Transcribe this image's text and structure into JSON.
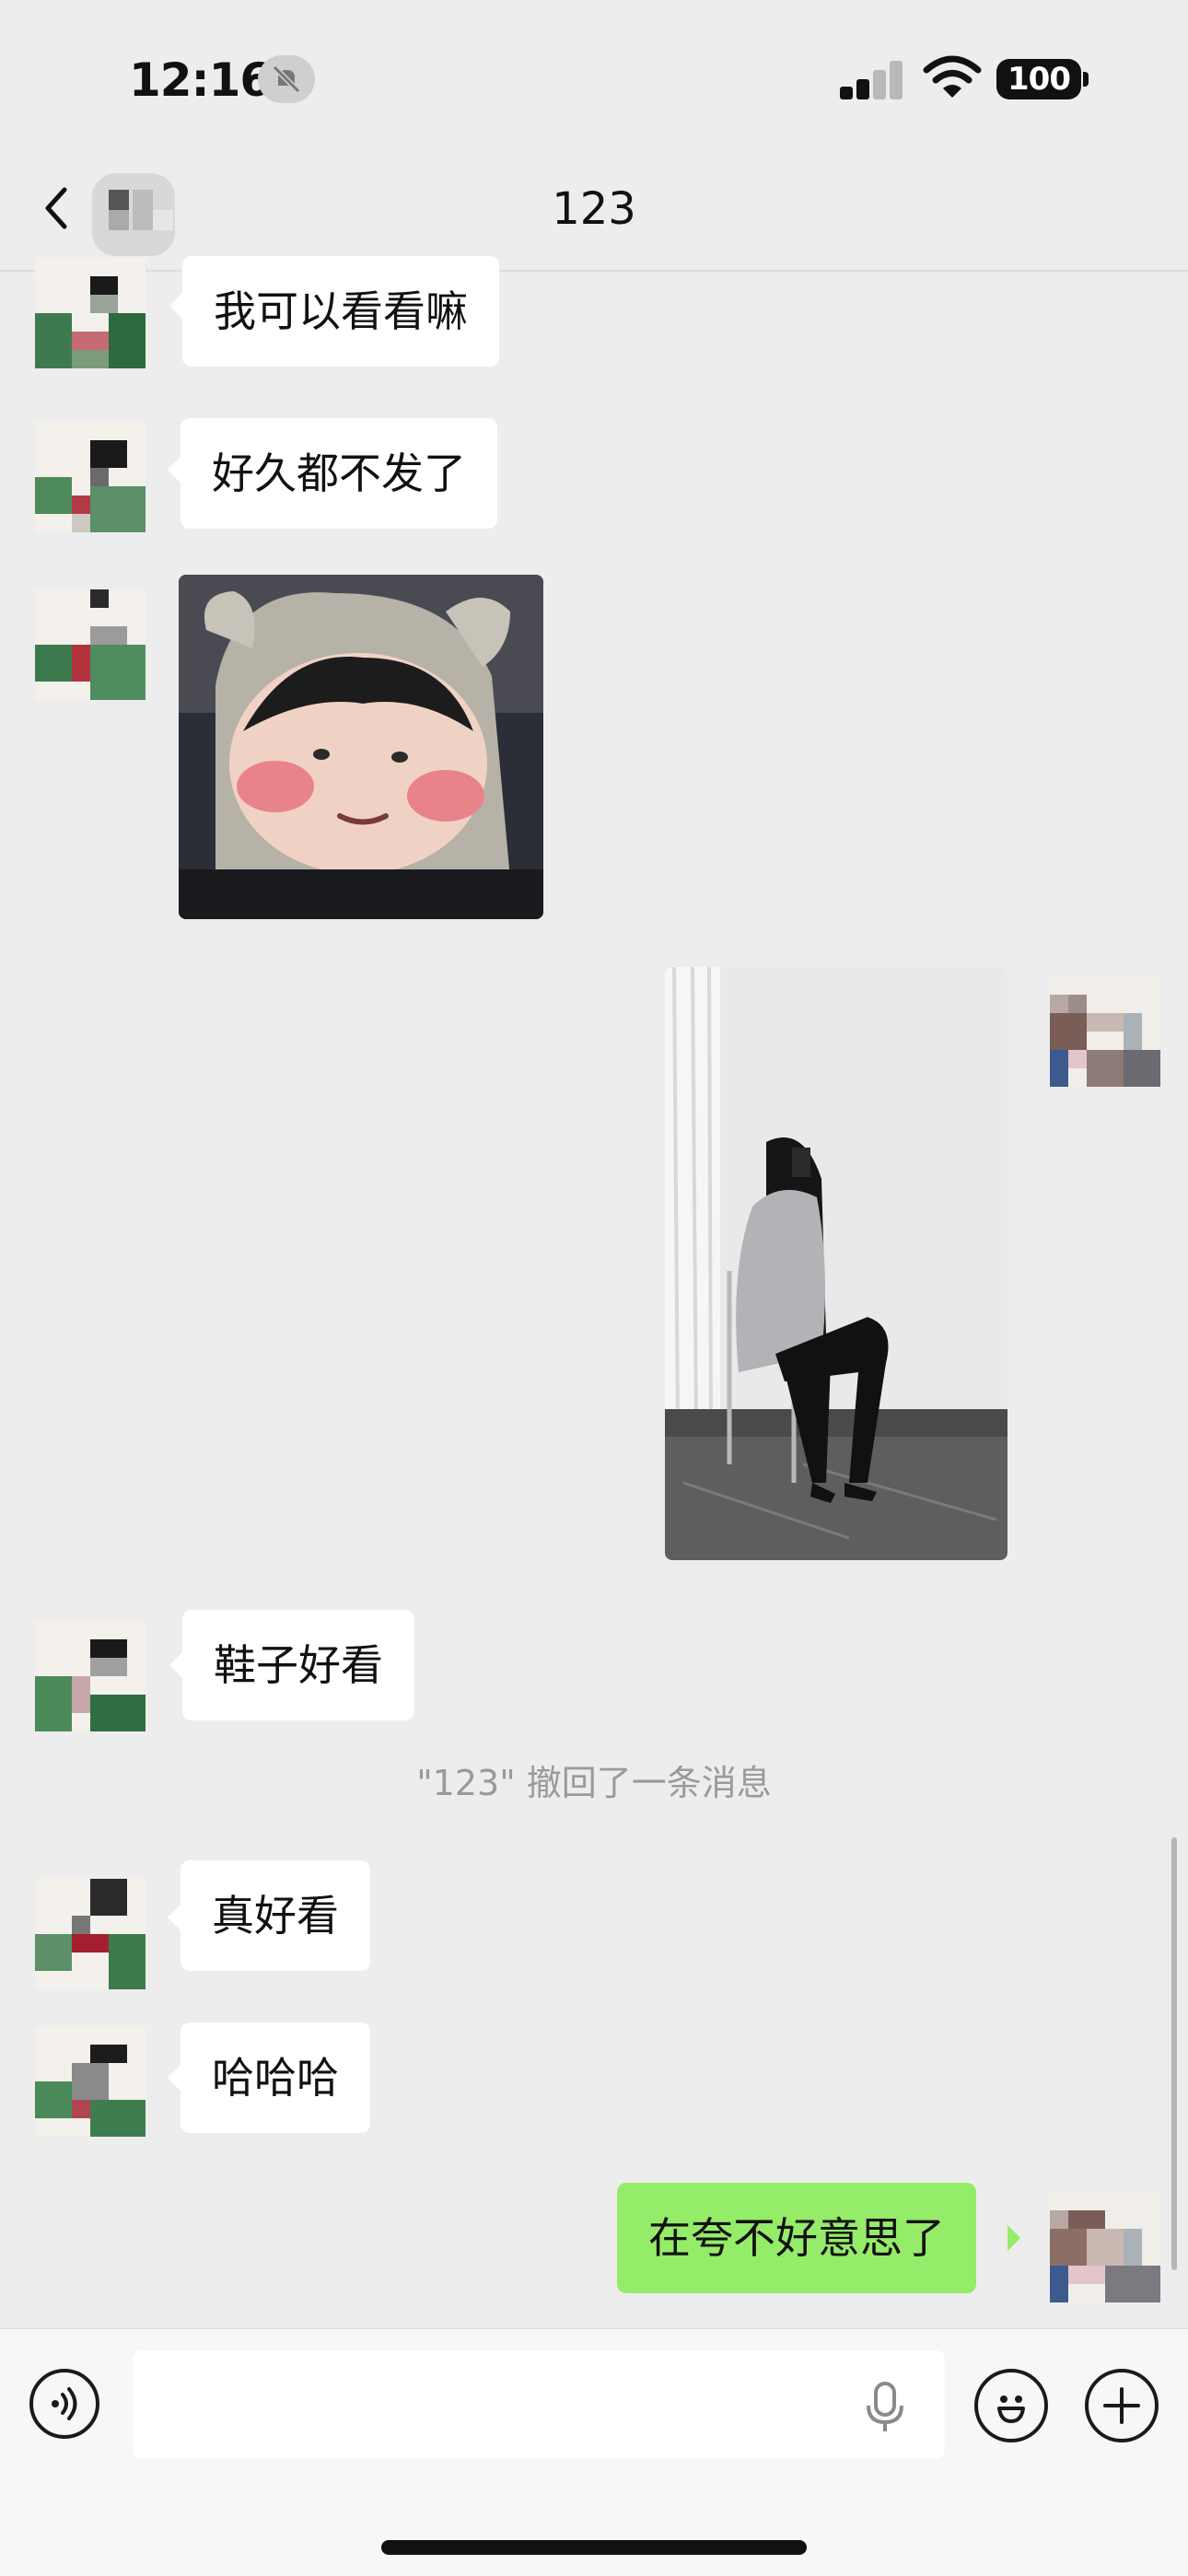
{
  "status_bar": {
    "time": "12:16",
    "battery": "100"
  },
  "nav": {
    "title": "123"
  },
  "messages": [
    {
      "text": "我可以看看嘛"
    },
    {
      "text": "好久都不发了"
    },
    {
      "text": "鞋子好看"
    },
    {
      "text": "真好看"
    },
    {
      "text": "哈哈哈"
    }
  ],
  "system_notice": "\"123\" 撤回了一条消息",
  "sent": {
    "text": "在夸不好意思了"
  },
  "icons": {
    "back": "chevron-left-icon",
    "dnd": "mute-bell-icon",
    "voice": "voice-icon",
    "mic": "microphone-icon",
    "emoji": "emoji-icon",
    "plus": "plus-icon"
  },
  "colors": {
    "background": "#ededed",
    "sent_bubble": "#95ec69",
    "received_bubble": "#ffffff"
  }
}
